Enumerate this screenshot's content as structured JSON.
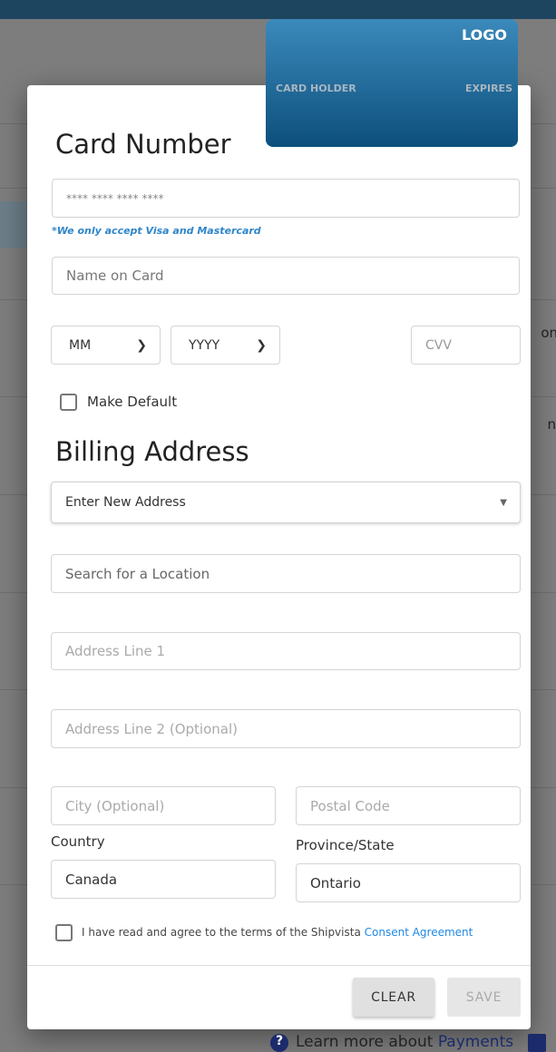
{
  "card_preview": {
    "logo": "LOGO",
    "card_holder": "CARD HOLDER",
    "expires": "EXPIRES",
    "colors": [
      "#3a8abb",
      "#0d4f7c"
    ]
  },
  "card_section": {
    "title": "Card Number",
    "card_number_placeholder": "**** **** **** ****",
    "note": "*We only accept Visa and Mastercard",
    "name_placeholder": "Name on Card",
    "month": "MM",
    "year": "YYYY",
    "cvv_placeholder": "CVV",
    "make_default": "Make Default"
  },
  "billing": {
    "title": "Billing Address",
    "address_select": "Enter New Address",
    "search_placeholder": "Search for a Location",
    "line1_placeholder": "Address Line 1",
    "line2_placeholder": "Address Line 2 (Optional)",
    "city_placeholder": "City (Optional)",
    "postal_placeholder": "Postal Code",
    "country_label": "Country",
    "country": "Canada",
    "province_label": "Province/State",
    "province": "Ontario"
  },
  "consent": {
    "text": "I have read and agree to the terms of the Shipvista ",
    "link": "Consent Agreement"
  },
  "buttons": {
    "clear": "CLEAR",
    "save": "SAVE"
  },
  "background": {
    "learn_more": "Learn more about ",
    "payments_link": "Payments",
    "partial_1": "on",
    "partial_2": "n"
  }
}
